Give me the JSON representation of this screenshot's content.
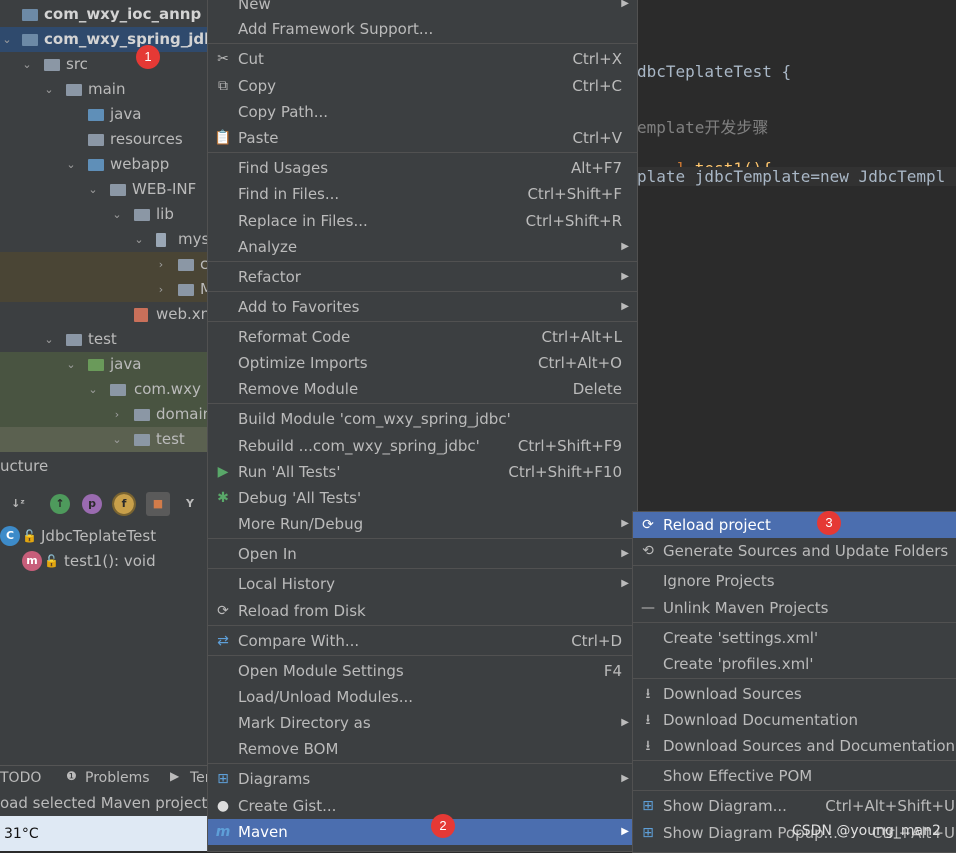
{
  "project_tree": {
    "rows": [
      {
        "label": "com_wxy_ioc_annp"
      },
      {
        "label": "com_wxy_spring_jdbc"
      },
      {
        "label": "src"
      },
      {
        "label": "main"
      },
      {
        "label": "java"
      },
      {
        "label": "resources"
      },
      {
        "label": "webapp"
      },
      {
        "label": "WEB-INF"
      },
      {
        "label": "lib"
      },
      {
        "label": "mys"
      },
      {
        "label": "c"
      },
      {
        "label": "M"
      },
      {
        "label": "web.xn"
      },
      {
        "label": "test"
      },
      {
        "label": "java"
      },
      {
        "label": "com.wxy"
      },
      {
        "label": "domain"
      },
      {
        "label": "test"
      }
    ]
  },
  "structure": {
    "title": "ucture",
    "toolbar_icons": [
      "sort-alpha-icon",
      "inherited-icon",
      "property-icon",
      "field-icon",
      "lock-icon",
      "hierarchy-icon"
    ],
    "class_name": "JdbcTeplateTest",
    "method": "test1(): void"
  },
  "bottom_tabs": {
    "todo": "TODO",
    "problems": "Problems",
    "terminal": "Ter"
  },
  "status_text": "oad selected Maven projects",
  "taskbar": {
    "temperature": "31°C"
  },
  "editor": {
    "lines": [
      "dbcTeplateTest {",
      "emplate开发步骤",
      "test1(){",
      "plate jdbcTemplate=new JdbcTempl"
    ]
  },
  "context_menu": {
    "items": [
      {
        "label": "New",
        "arrow": true
      },
      {
        "label": "Add Framework Support..."
      },
      {
        "label": "Cut",
        "shortcut": "Ctrl+X",
        "icon": "scissors-icon"
      },
      {
        "label": "Copy",
        "shortcut": "Ctrl+C",
        "icon": "copy-icon"
      },
      {
        "label": "Copy Path..."
      },
      {
        "label": "Paste",
        "shortcut": "Ctrl+V",
        "icon": "paste-icon"
      },
      {
        "label": "Find Usages",
        "shortcut": "Alt+F7"
      },
      {
        "label": "Find in Files...",
        "shortcut": "Ctrl+Shift+F"
      },
      {
        "label": "Replace in Files...",
        "shortcut": "Ctrl+Shift+R"
      },
      {
        "label": "Analyze",
        "arrow": true
      },
      {
        "label": "Refactor",
        "arrow": true
      },
      {
        "label": "Add to Favorites",
        "arrow": true
      },
      {
        "label": "Reformat Code",
        "shortcut": "Ctrl+Alt+L"
      },
      {
        "label": "Optimize Imports",
        "shortcut": "Ctrl+Alt+O"
      },
      {
        "label": "Remove Module",
        "shortcut": "Delete"
      },
      {
        "label": "Build Module 'com_wxy_spring_jdbc'"
      },
      {
        "label": "Rebuild ...com_wxy_spring_jdbc'",
        "shortcut": "Ctrl+Shift+F9"
      },
      {
        "label": "Run 'All Tests'",
        "shortcut": "Ctrl+Shift+F10",
        "icon": "run-icon"
      },
      {
        "label": "Debug 'All Tests'",
        "icon": "debug-icon"
      },
      {
        "label": "More Run/Debug",
        "arrow": true
      },
      {
        "label": "Open In",
        "arrow": true
      },
      {
        "label": "Local History",
        "arrow": true
      },
      {
        "label": "Reload from Disk",
        "icon": "reload-icon"
      },
      {
        "label": "Compare With...",
        "shortcut": "Ctrl+D",
        "icon": "compare-icon"
      },
      {
        "label": "Open Module Settings",
        "shortcut": "F4"
      },
      {
        "label": "Load/Unload Modules..."
      },
      {
        "label": "Mark Directory as",
        "arrow": true
      },
      {
        "label": "Remove BOM"
      },
      {
        "label": "Diagrams",
        "arrow": true,
        "icon": "diagram-icon"
      },
      {
        "label": "Create Gist...",
        "icon": "github-icon"
      },
      {
        "label": "Maven",
        "arrow": true,
        "icon": "maven-icon",
        "highlighted": true
      }
    ]
  },
  "maven_submenu": {
    "items": [
      {
        "label": "Reload project",
        "icon": "reload-icon",
        "highlighted": true
      },
      {
        "label": "Generate Sources and Update Folders",
        "icon": "generate-icon"
      },
      {
        "label": "Ignore Projects"
      },
      {
        "label": "Unlink Maven Projects",
        "icon": "minus-icon"
      },
      {
        "label": "Create 'settings.xml'"
      },
      {
        "label": "Create 'profiles.xml'"
      },
      {
        "label": "Download Sources",
        "icon": "download-icon"
      },
      {
        "label": "Download Documentation",
        "icon": "download-icon"
      },
      {
        "label": "Download Sources and Documentation",
        "icon": "download-icon"
      },
      {
        "label": "Show Effective POM"
      },
      {
        "label": "Show Diagram...",
        "shortcut": "Ctrl+Alt+Shift+U",
        "icon": "diagram-icon"
      },
      {
        "label": "Show Diagram Popup...",
        "shortcut": "Ctrl+Alt+U",
        "icon": "diagram-icon"
      }
    ]
  },
  "badges": [
    "1",
    "2",
    "3"
  ],
  "watermark": "CSDN @young_man2"
}
